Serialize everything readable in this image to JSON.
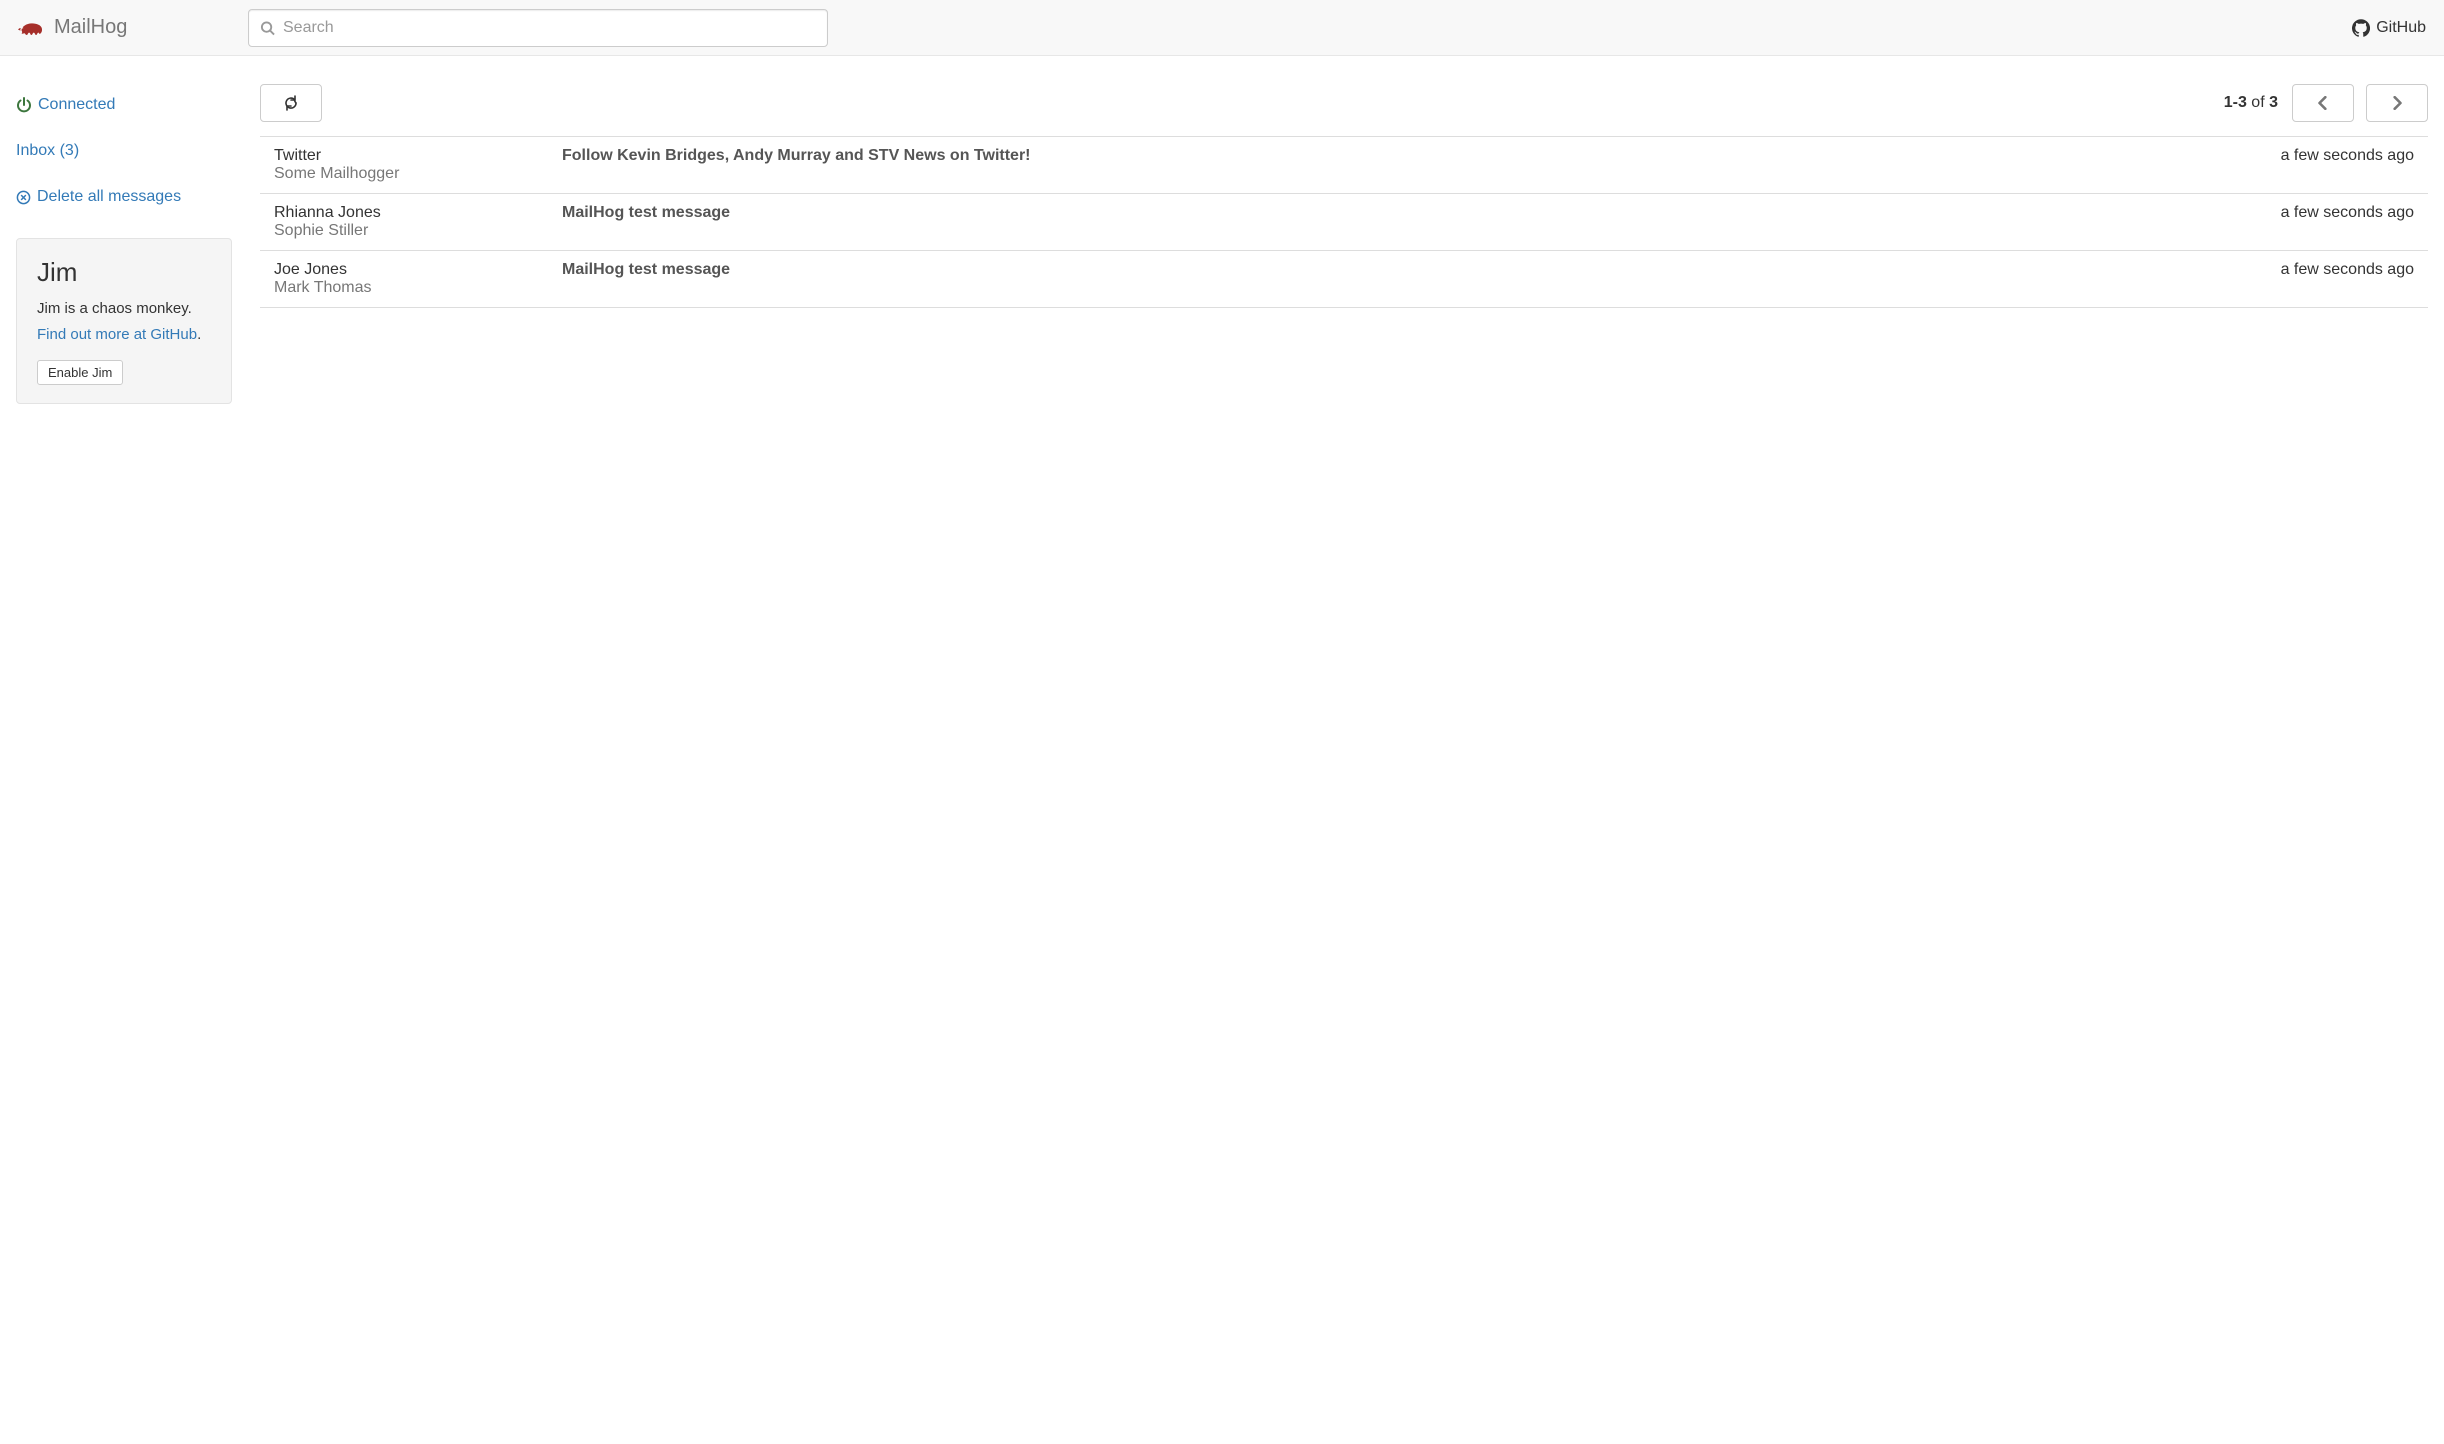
{
  "brand": {
    "name": "MailHog"
  },
  "search": {
    "placeholder": "Search"
  },
  "github": {
    "label": "GitHub"
  },
  "sidebar": {
    "connected_label": "Connected",
    "inbox_label": "Inbox (3)",
    "delete_all_label": "Delete all messages"
  },
  "jim": {
    "title": "Jim",
    "desc": "Jim is a chaos monkey.",
    "link_text": "Find out more at GitHub",
    "period": ".",
    "button_label": "Enable Jim"
  },
  "pager": {
    "range": "1-3",
    "of": " of ",
    "total": "3"
  },
  "messages": [
    {
      "from": "Twitter",
      "to": "Some Mailhogger",
      "subject": "Follow Kevin Bridges, Andy Murray and STV News on Twitter!",
      "time": "a few seconds ago"
    },
    {
      "from": "Rhianna Jones",
      "to": "Sophie Stiller",
      "subject": "MailHog test message",
      "time": "a few seconds ago"
    },
    {
      "from": "Joe Jones",
      "to": "Mark Thomas",
      "subject": "MailHog test message",
      "time": "a few seconds ago"
    }
  ]
}
